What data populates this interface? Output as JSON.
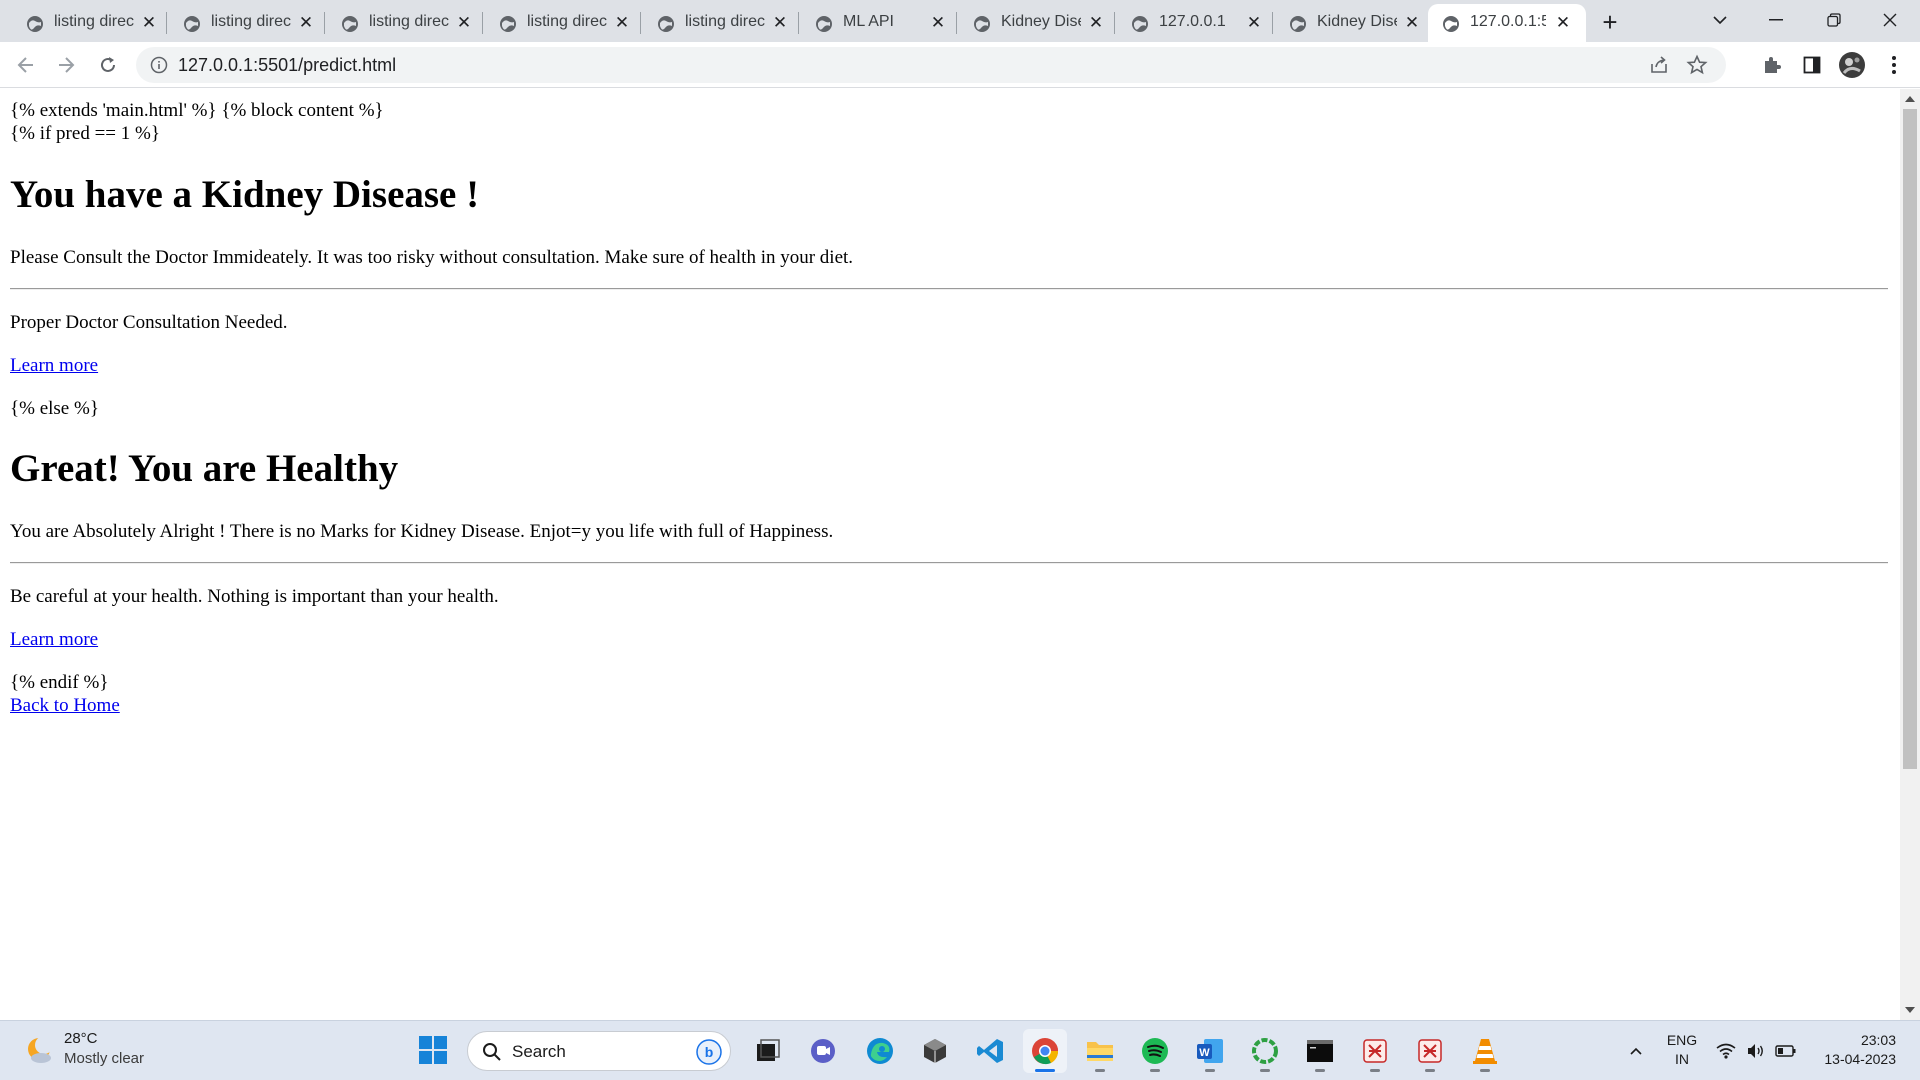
{
  "browser": {
    "tabs": [
      {
        "title": "listing direc"
      },
      {
        "title": "listing direc"
      },
      {
        "title": "listing direc"
      },
      {
        "title": "listing direc"
      },
      {
        "title": "listing direc"
      },
      {
        "title": "ML API"
      },
      {
        "title": "Kidney Dise"
      },
      {
        "title": "127.0.0.1"
      },
      {
        "title": "Kidney Dise"
      },
      {
        "title": "127.0.0.1:55"
      }
    ],
    "active_tab_index": 9,
    "url": "127.0.0.1:5501/predict.html"
  },
  "page": {
    "line1": "{% extends 'main.html' %} {% block content %}",
    "line2": "{% if pred == 1 %}",
    "heading_disease": "You have a Kidney Disease !",
    "para_disease": "Please Consult the Doctor Immideately. It was too risky without consultation. Make sure of health in your diet.",
    "note_disease": "Proper Doctor Consultation Needed.",
    "learn_more_1": "Learn more",
    "else_tag": "{% else %}",
    "heading_healthy": "Great! You are Healthy",
    "para_healthy": "You are Absolutely Alright ! There is no Marks for Kidney Disease. Enjot=y you life with full of Happiness.",
    "note_healthy": "Be careful at your health. Nothing is important than your health.",
    "learn_more_2": "Learn more",
    "endif_tag": "{% endif %}",
    "back_home": "Back to Home"
  },
  "taskbar": {
    "weather_temp": "28°C",
    "weather_cond": "Mostly clear",
    "search_label": "Search",
    "lang_line1": "ENG",
    "lang_line2": "IN",
    "time": "23:03",
    "date": "13-04-2023"
  },
  "colors": {
    "tabstrip": "#dee1e6",
    "link": "#0000ee",
    "taskbar": "#dfe6f1",
    "chrome_active_indicator": "#1a73e8"
  }
}
